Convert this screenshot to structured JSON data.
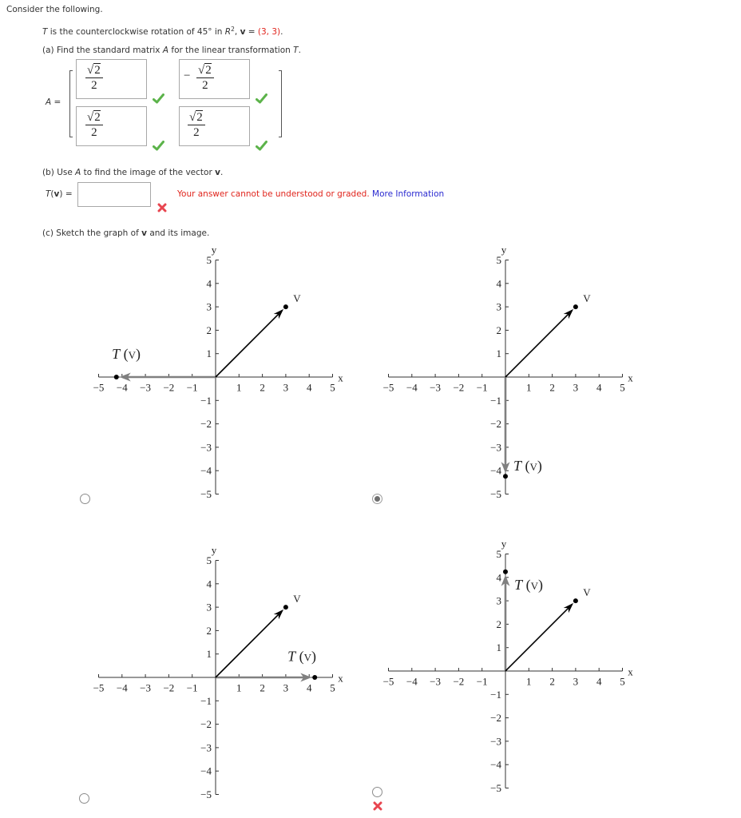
{
  "header": {
    "intro": "Consider the following."
  },
  "problem": {
    "statement": {
      "map_name": "T",
      "text": " is the counterclockwise rotation of 45° in ",
      "space_name": "R",
      "space_dim": "2",
      "sep": ", ",
      "vector_name": "v",
      "equals": " = ",
      "vector_value": "(3, 3)",
      "end": "."
    },
    "part_a": {
      "label_prefix": "(a) Find the standard matrix ",
      "matrix_name": "A",
      "label_mid": " for the linear transformation ",
      "map_name": "T",
      "label_end": ".",
      "lhs": "A =",
      "entries": [
        [
          {
            "sign": "",
            "radical": "√",
            "radicand": "2",
            "denominator": "2",
            "status": "correct"
          },
          {
            "sign": "−",
            "radical": "√",
            "radicand": "2",
            "denominator": "2",
            "status": "correct"
          }
        ],
        [
          {
            "sign": "",
            "radical": "√",
            "radicand": "2",
            "denominator": "2",
            "status": "correct"
          },
          {
            "sign": "",
            "radical": "√",
            "radicand": "2",
            "denominator": "2",
            "status": "correct"
          }
        ]
      ]
    },
    "part_b": {
      "label_prefix": "(b) Use ",
      "matrix_name": "A",
      "label_mid": " to find the image of the vector ",
      "vector_name": "v",
      "label_end": ".",
      "lhs_map": "T",
      "lhs_open": "(",
      "lhs_vector": "v",
      "lhs_close": ") =",
      "answer_value": "",
      "status": "incorrect",
      "error_message": "Your answer cannot be understood or graded. ",
      "more_info_link": "More Information"
    },
    "part_c": {
      "label_prefix": "(c) Sketch the graph of ",
      "vector_name": "v",
      "label_end": " and its image.",
      "options": [
        {
          "selected": false,
          "feedback": null
        },
        {
          "selected": true,
          "feedback": null
        },
        {
          "selected": false,
          "feedback": null
        },
        {
          "selected": false,
          "feedback": "incorrect"
        }
      ]
    }
  },
  "colors": {
    "text": "#333333",
    "highlight_red": "#e0241c",
    "link_blue": "#2a2ad0",
    "correct_green": "#5cb34a",
    "incorrect_red": "#e8454f",
    "axis": "#333333",
    "vector_v": "#000000",
    "vector_Tv": "#808080"
  },
  "chart_data": [
    {
      "type": "line",
      "title": "",
      "xlabel": "x",
      "ylabel": "y",
      "xlim": [
        -5,
        5
      ],
      "ylim": [
        -5,
        5
      ],
      "grid": false,
      "xtick_values": [
        -5,
        -4,
        -3,
        -2,
        -1,
        1,
        2,
        3,
        4,
        5
      ],
      "xtick_labels": [
        "−5",
        "−4",
        "−3",
        "−2",
        "−1",
        "1",
        "2",
        "3",
        "4",
        "5"
      ],
      "ytick_values": [
        -5,
        -4,
        -3,
        -2,
        -1,
        1,
        2,
        3,
        4,
        5
      ],
      "ytick_labels": [
        "−5",
        "−4",
        "−3",
        "−2",
        "−1",
        "1",
        "2",
        "3",
        "4",
        "5"
      ],
      "series": [
        {
          "name": "v",
          "label": "v",
          "from": [
            0,
            0
          ],
          "to": [
            3,
            3
          ],
          "color": "#000000"
        },
        {
          "name": "T(v)",
          "label_main": "T",
          "label_arg": " (v)",
          "from": [
            0,
            0
          ],
          "to": [
            -4.24,
            0
          ],
          "color": "#808080"
        }
      ]
    },
    {
      "type": "line",
      "title": "",
      "xlabel": "x",
      "ylabel": "y",
      "xlim": [
        -5,
        5
      ],
      "ylim": [
        -5,
        5
      ],
      "grid": false,
      "xtick_values": [
        -5,
        -4,
        -3,
        -2,
        -1,
        1,
        2,
        3,
        4,
        5
      ],
      "xtick_labels": [
        "−5",
        "−4",
        "−3",
        "−2",
        "−1",
        "1",
        "2",
        "3",
        "4",
        "5"
      ],
      "ytick_values": [
        -5,
        -4,
        -3,
        -2,
        -1,
        1,
        2,
        3,
        4,
        5
      ],
      "ytick_labels": [
        "−5",
        "−4",
        "−3",
        "−2",
        "−1",
        "1",
        "2",
        "3",
        "4",
        "5"
      ],
      "series": [
        {
          "name": "v",
          "label": "v",
          "from": [
            0,
            0
          ],
          "to": [
            3,
            3
          ],
          "color": "#000000"
        },
        {
          "name": "T(v)",
          "label_main": "T",
          "label_arg": " (v)",
          "from": [
            0,
            0
          ],
          "to": [
            0,
            -4.24
          ],
          "color": "#808080"
        }
      ]
    },
    {
      "type": "line",
      "title": "",
      "xlabel": "x",
      "ylabel": "y",
      "xlim": [
        -5,
        5
      ],
      "ylim": [
        -5,
        5
      ],
      "grid": false,
      "xtick_values": [
        -5,
        -4,
        -3,
        -2,
        -1,
        1,
        2,
        3,
        4,
        5
      ],
      "xtick_labels": [
        "−5",
        "−4",
        "−3",
        "−2",
        "−1",
        "1",
        "2",
        "3",
        "4",
        "5"
      ],
      "ytick_values": [
        -5,
        -4,
        -3,
        -2,
        -1,
        1,
        2,
        3,
        4,
        5
      ],
      "ytick_labels": [
        "−5",
        "−4",
        "−3",
        "−2",
        "−1",
        "1",
        "2",
        "3",
        "4",
        "5"
      ],
      "series": [
        {
          "name": "v",
          "label": "v",
          "from": [
            0,
            0
          ],
          "to": [
            3,
            3
          ],
          "color": "#000000"
        },
        {
          "name": "T(v)",
          "label_main": "T",
          "label_arg": " (v)",
          "from": [
            0,
            0
          ],
          "to": [
            4.24,
            0
          ],
          "color": "#808080"
        }
      ]
    },
    {
      "type": "line",
      "title": "",
      "xlabel": "x",
      "ylabel": "y",
      "xlim": [
        -5,
        5
      ],
      "ylim": [
        -5,
        5
      ],
      "grid": false,
      "xtick_values": [
        -5,
        -4,
        -3,
        -2,
        -1,
        1,
        2,
        3,
        4,
        5
      ],
      "xtick_labels": [
        "−5",
        "−4",
        "−3",
        "−2",
        "−1",
        "1",
        "2",
        "3",
        "4",
        "5"
      ],
      "ytick_values": [
        -5,
        -4,
        -3,
        -2,
        -1,
        1,
        2,
        3,
        4,
        5
      ],
      "ytick_labels": [
        "−5",
        "−4",
        "−3",
        "−2",
        "−1",
        "1",
        "2",
        "3",
        "4",
        "5"
      ],
      "series": [
        {
          "name": "v",
          "label": "v",
          "from": [
            0,
            0
          ],
          "to": [
            3,
            3
          ],
          "color": "#000000"
        },
        {
          "name": "T(v)",
          "label_main": "T",
          "label_arg": " (v)",
          "from": [
            0,
            0
          ],
          "to": [
            0,
            4.24
          ],
          "color": "#808080"
        }
      ]
    }
  ]
}
